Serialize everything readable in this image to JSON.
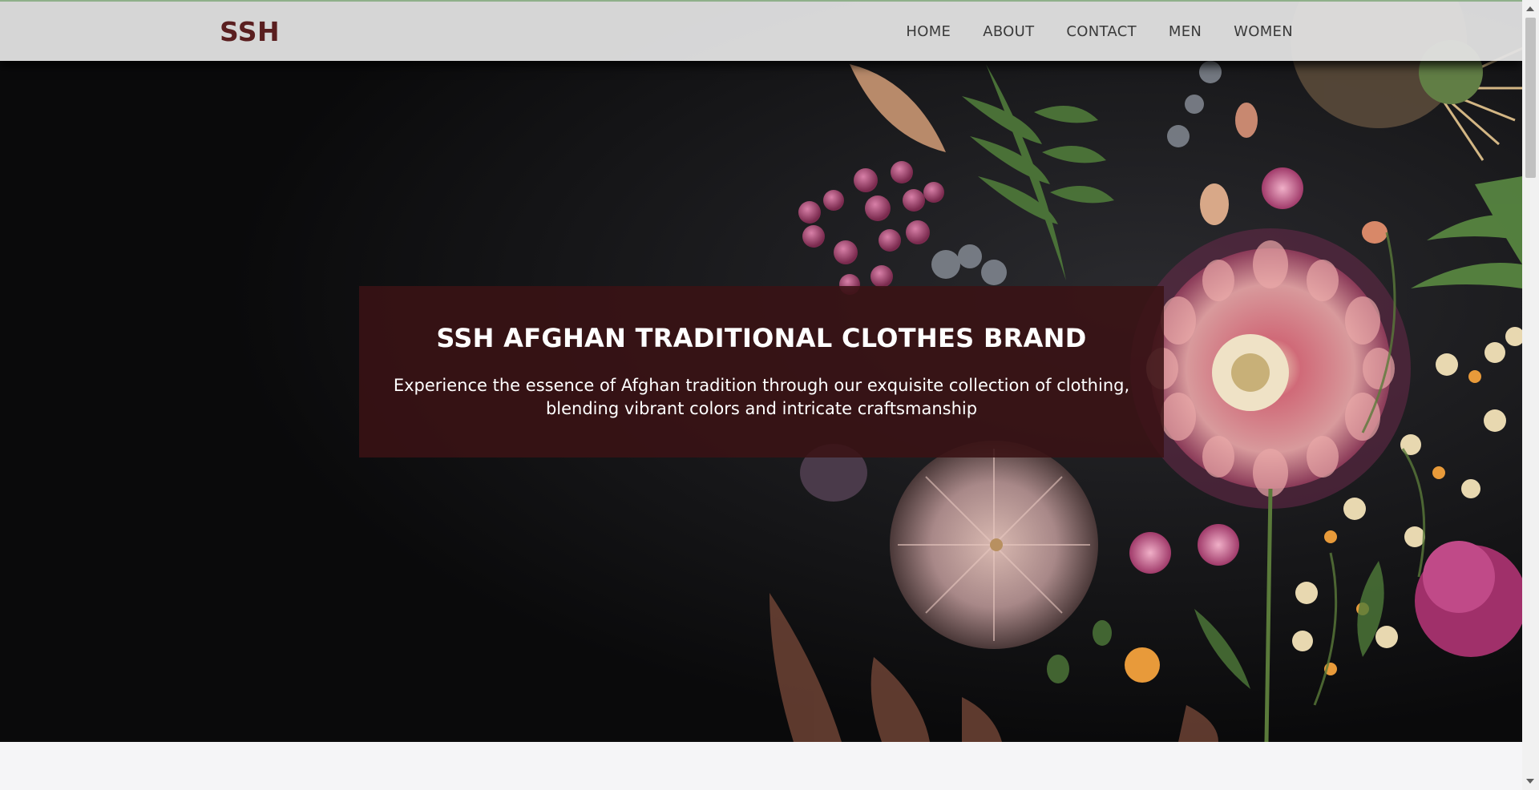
{
  "navbar": {
    "brand": "SSH",
    "links": [
      "HOME",
      "ABOUT",
      "CONTACT",
      "MEN",
      "WOMEN"
    ]
  },
  "hero": {
    "title": "SSH AFGHAN TRADITIONAL CLOTHES BRAND",
    "subtitle_line1": "Experience the essence of Afghan tradition through our exquisite collection of clothing,",
    "subtitle_line2": "blending vibrant colors and intricate craftsmanship"
  },
  "colors": {
    "brand": "#5a1e1f",
    "hero_box": "#3a1214",
    "navbar_bg": "#e2e2e2",
    "hero_bg": "#0b0b0c"
  },
  "icons": [
    "scroll-up-arrow-icon",
    "scroll-down-arrow-icon"
  ]
}
